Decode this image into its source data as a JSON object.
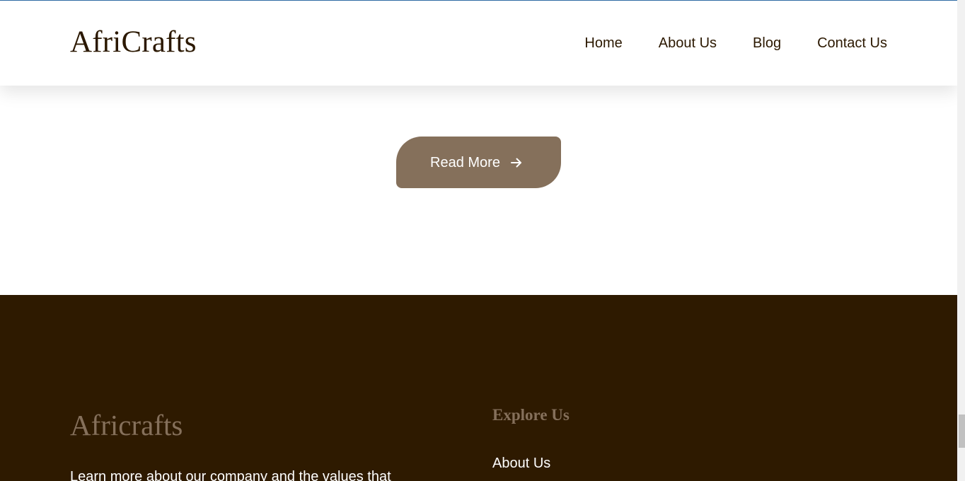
{
  "header": {
    "logo": "AfriCrafts",
    "nav": [
      {
        "label": "Home"
      },
      {
        "label": "About Us"
      },
      {
        "label": "Blog"
      },
      {
        "label": "Contact Us"
      }
    ]
  },
  "main": {
    "read_more_label": "Read More",
    "read_more_icon": "arrow-right-icon"
  },
  "footer": {
    "brand": "Africrafts",
    "description": "Learn more about our company and the values that",
    "explore": {
      "title": "Explore Us",
      "links": [
        {
          "label": "About Us"
        }
      ]
    }
  },
  "colors": {
    "brand_brown": "#85705b",
    "dark_brown": "#2e1a00",
    "text_dark": "#2b1800",
    "top_accent": "#2f6aa3"
  }
}
